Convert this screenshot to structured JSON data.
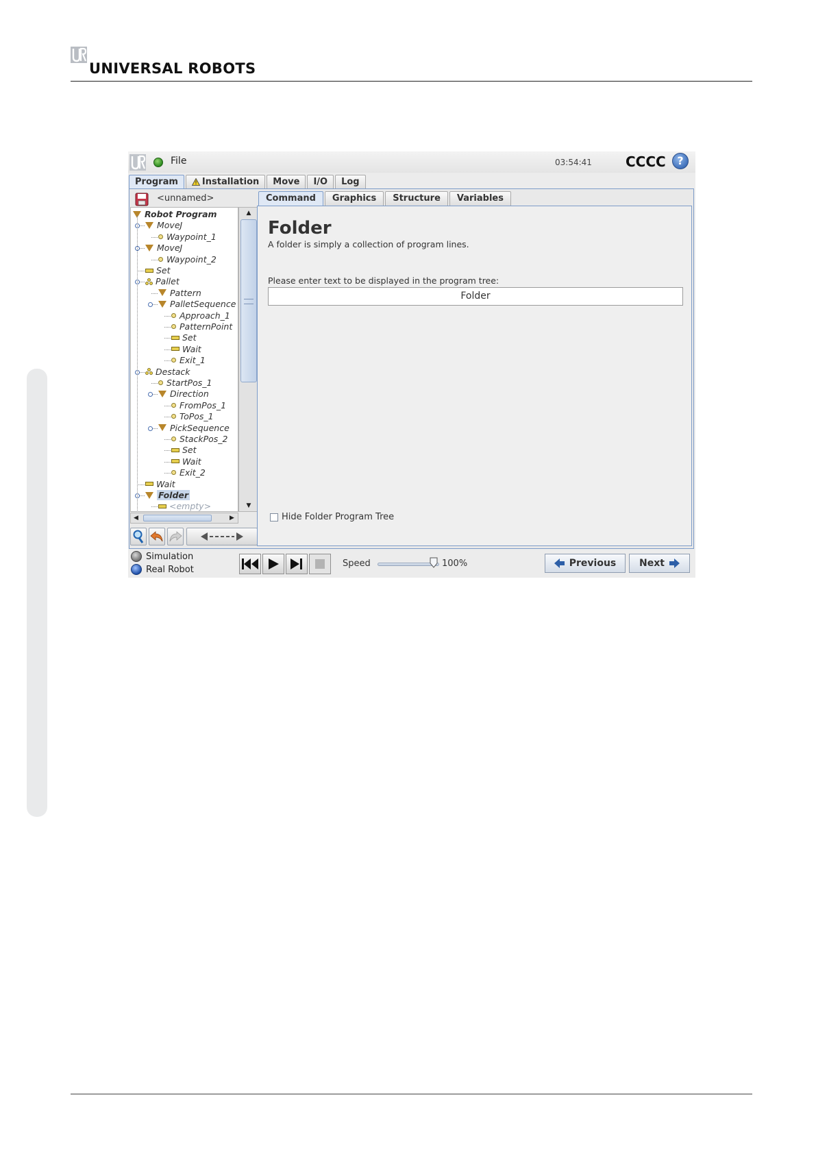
{
  "document": {
    "brand": "UNIVERSAL ROBOTS"
  },
  "app": {
    "file_menu": "File",
    "clock": "03:54:41",
    "robot_name": "CCCC",
    "help_label": "?",
    "main_tabs": [
      {
        "label": "Program",
        "active": true
      },
      {
        "label": "Installation",
        "active": false,
        "warning": true
      },
      {
        "label": "Move",
        "active": false
      },
      {
        "label": "I/O",
        "active": false
      },
      {
        "label": "Log",
        "active": false
      }
    ],
    "program_name": "<unnamed>",
    "tree": [
      {
        "label": "Robot Program",
        "icon": "triangle"
      },
      {
        "label": "MoveJ",
        "icon": "triangle"
      },
      {
        "label": "Waypoint_1",
        "icon": "waypoint-dot"
      },
      {
        "label": "MoveJ",
        "icon": "triangle"
      },
      {
        "label": "Waypoint_2",
        "icon": "waypoint-dot"
      },
      {
        "label": "Set",
        "icon": "bar"
      },
      {
        "label": "Pallet",
        "icon": "pallet"
      },
      {
        "label": "Pattern",
        "icon": "triangle"
      },
      {
        "label": "PalletSequence",
        "icon": "triangle"
      },
      {
        "label": "Approach_1",
        "icon": "waypoint-dot"
      },
      {
        "label": "PatternPoint",
        "icon": "waypoint-dot"
      },
      {
        "label": "Set",
        "icon": "bar"
      },
      {
        "label": "Wait",
        "icon": "bar"
      },
      {
        "label": "Exit_1",
        "icon": "waypoint-dot"
      },
      {
        "label": "Destack",
        "icon": "pallet"
      },
      {
        "label": "StartPos_1",
        "icon": "waypoint-dot"
      },
      {
        "label": "Direction",
        "icon": "triangle"
      },
      {
        "label": "FromPos_1",
        "icon": "waypoint-dot"
      },
      {
        "label": "ToPos_1",
        "icon": "waypoint-dot"
      },
      {
        "label": "PickSequence",
        "icon": "triangle"
      },
      {
        "label": "StackPos_2",
        "icon": "waypoint-dot"
      },
      {
        "label": "Set",
        "icon": "bar"
      },
      {
        "label": "Wait",
        "icon": "bar"
      },
      {
        "label": "Exit_2",
        "icon": "waypoint-dot"
      },
      {
        "label": "Wait",
        "icon": "bar"
      },
      {
        "label": "Folder",
        "icon": "triangle"
      },
      {
        "label": "<empty>",
        "icon": "bar"
      }
    ],
    "sub_tabs": [
      {
        "label": "Command",
        "active": true
      },
      {
        "label": "Graphics",
        "active": false
      },
      {
        "label": "Structure",
        "active": false
      },
      {
        "label": "Variables",
        "active": false
      }
    ],
    "command": {
      "title": "Folder",
      "description": "A folder is simply a collection of program lines.",
      "prompt": "Please enter text to be displayed in the program tree:",
      "input_value": "Folder",
      "checkbox_label": "Hide Folder Program Tree",
      "checkbox_checked": false
    },
    "bottom": {
      "simulation_label": "Simulation",
      "real_robot_label": "Real Robot",
      "mode_selected": "Real Robot",
      "speed_label": "Speed",
      "speed_value": "100%",
      "speed_fraction": 1.0,
      "previous_label": "Previous",
      "next_label": "Next"
    }
  }
}
